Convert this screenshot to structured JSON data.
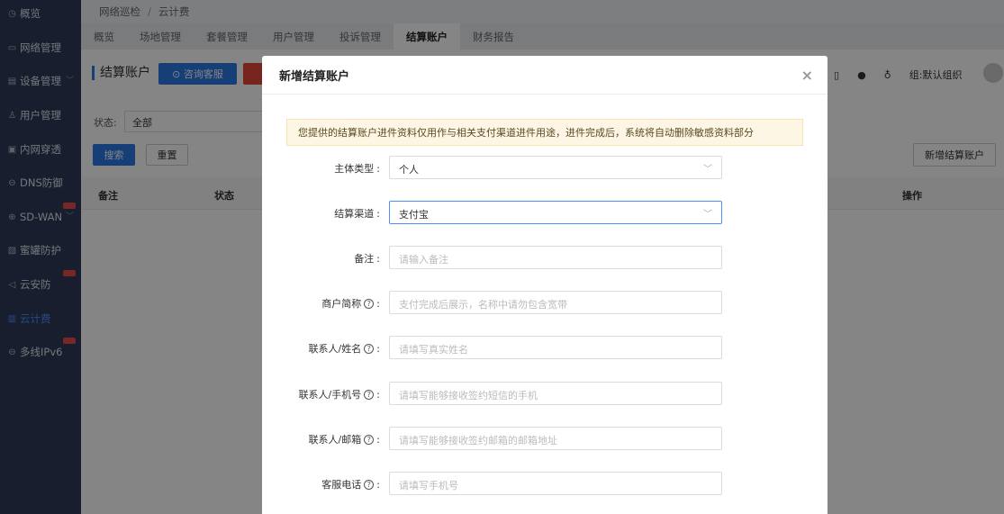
{
  "sidebar": {
    "items": [
      {
        "label": "概览",
        "icon": "dashboard-icon",
        "glyph": "◷"
      },
      {
        "label": "网络管理",
        "icon": "monitor-icon",
        "glyph": "▭"
      },
      {
        "label": "设备管理",
        "icon": "device-icon",
        "glyph": "▤"
      },
      {
        "label": "用户管理",
        "icon": "user-icon",
        "glyph": "♙"
      },
      {
        "label": "内网穿透",
        "icon": "tunnel-icon",
        "glyph": "▣"
      },
      {
        "label": "DNS防御",
        "icon": "shield-icon",
        "glyph": "⊖"
      },
      {
        "label": "SD-WAN",
        "icon": "globe-icon",
        "glyph": "⊕"
      },
      {
        "label": "蜜罐防护",
        "icon": "honeypot-icon",
        "glyph": "▧"
      },
      {
        "label": "云安防",
        "icon": "megaphone-icon",
        "glyph": "◁"
      },
      {
        "label": "云计费",
        "icon": "billing-icon",
        "glyph": "▥"
      },
      {
        "label": "多线IPv6",
        "icon": "ipv6-icon",
        "glyph": "⊖"
      }
    ]
  },
  "breadcrumb": {
    "first": "网络巡检",
    "separator": "/",
    "second": "云计费"
  },
  "tabs": [
    "概览",
    "场地管理",
    "套餐管理",
    "用户管理",
    "投诉管理",
    "结算账户",
    "财务报告"
  ],
  "page": {
    "title": "结算账户",
    "consult_button": "咨询客服",
    "status_label": "状态:",
    "status_value": "全部",
    "search_button": "搜索",
    "reset_button": "重置",
    "new_button": "新增结算账户",
    "columns": {
      "remark": "备注",
      "status": "状态",
      "actions": "操作"
    },
    "group_label": "组:默认组织"
  },
  "modal": {
    "title": "新增结算账户",
    "close_glyph": "×",
    "notice": "您提供的结算账户进件资料仅用作与相关支付渠道进件用途，进件完成后，系统将自动删除敏感资料部分",
    "fields": [
      {
        "label": "主体类型",
        "value": "个人",
        "placeholder": "",
        "help": false,
        "select": true
      },
      {
        "label": "结算渠道",
        "value": "支付宝",
        "placeholder": "",
        "help": false,
        "select": true
      },
      {
        "label": "备注",
        "value": "",
        "placeholder": "请输入备注",
        "help": false,
        "select": false
      },
      {
        "label": "商户简称",
        "value": "",
        "placeholder": "支付完成后展示，名称中请勿包含宽带",
        "help": true,
        "select": false
      },
      {
        "label": "联系人/姓名",
        "value": "",
        "placeholder": "请填写真实姓名",
        "help": true,
        "select": false
      },
      {
        "label": "联系人/手机号",
        "value": "",
        "placeholder": "请填写能够接收签约短信的手机",
        "help": true,
        "select": false
      },
      {
        "label": "联系人/邮箱",
        "value": "",
        "placeholder": "请填写能够接收签约邮箱的邮箱地址",
        "help": true,
        "select": false
      },
      {
        "label": "客服电话",
        "value": "",
        "placeholder": "请填写手机号",
        "help": true,
        "select": false
      }
    ]
  },
  "colors": {
    "primary": "#2b77e5",
    "sidebar": "#2f3a56",
    "danger": "#e5433b"
  }
}
